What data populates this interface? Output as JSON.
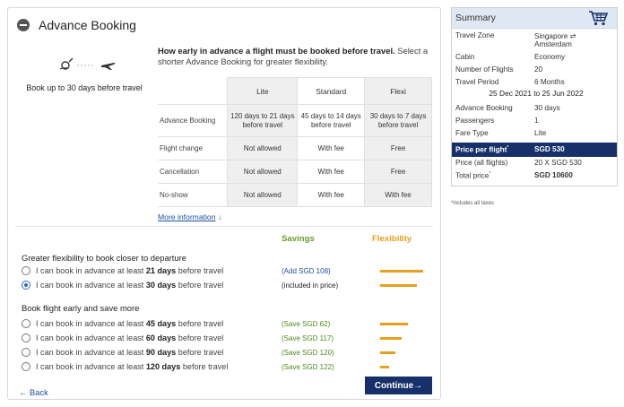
{
  "header": {
    "title": "Advance Booking"
  },
  "limit_text": "Book up to 30 days before travel",
  "description": {
    "bold": "How early in advance a flight must be booked before travel.",
    "rest": " Select a shorter Advance Booking for greater flexibility."
  },
  "fare_table": {
    "columns": [
      "Lite",
      "Standard",
      "Flexi"
    ],
    "rows": [
      {
        "label": "Advance Booking",
        "values": [
          "120 days to 21 days before travel",
          "45 days to 14 days before travel",
          "30 days to 7 days before travel"
        ]
      },
      {
        "label": "Flight change",
        "values": [
          "Not allowed",
          "With fee",
          "Free"
        ]
      },
      {
        "label": "Cancellation",
        "values": [
          "Not allowed",
          "With fee",
          "Free"
        ]
      },
      {
        "label": "No-show",
        "values": [
          "Not allowed",
          "With fee",
          "With fee"
        ]
      }
    ]
  },
  "more_info": {
    "label": "More information",
    "arrow": "↓"
  },
  "columns_head": {
    "savings": "Savings",
    "flexibility": "Flexibility"
  },
  "groups": [
    {
      "title": "Greater flexibility to book closer to departure",
      "options": [
        {
          "prefix": "I can book in advance at least",
          "days": "21 days",
          "suffix": "before travel",
          "price": "(Add SGD 108)",
          "price_color": "#1f4fa3",
          "selected": false,
          "flexibility": 1.0
        },
        {
          "prefix": "I can book in advance at least",
          "days": "30 days",
          "suffix": "before travel",
          "price": "(included in price)",
          "price_color": "#222222",
          "selected": true,
          "flexibility": 0.85
        }
      ]
    },
    {
      "title": "Book flight early and save more",
      "options": [
        {
          "prefix": "I can book in advance at least",
          "days": "45 days",
          "suffix": "before travel",
          "price": "(Save SGD 62)",
          "price_color": "#4e8a1e",
          "selected": false,
          "flexibility": 0.65
        },
        {
          "prefix": "I can book in advance at least",
          "days": "60 days",
          "suffix": "before travel",
          "price": "(Save SGD 117)",
          "price_color": "#4e8a1e",
          "selected": false,
          "flexibility": 0.5
        },
        {
          "prefix": "I can book in advance at least",
          "days": "90 days",
          "suffix": "before travel",
          "price": "(Save SGD 120)",
          "price_color": "#4e8a1e",
          "selected": false,
          "flexibility": 0.35
        },
        {
          "prefix": "I can book in advance at least",
          "days": "120 days",
          "suffix": "before travel",
          "price": "(Save SGD 122)",
          "price_color": "#4e8a1e",
          "selected": false,
          "flexibility": 0.2
        }
      ]
    }
  ],
  "nav": {
    "back": "← Back",
    "continue": "Continue→"
  },
  "summary": {
    "title": "Summary",
    "travel_zone": {
      "label": "Travel Zone",
      "line1": "Singapore ⇌",
      "line2": "Amsterdam"
    },
    "cabin": {
      "label": "Cabin",
      "value": "Economy"
    },
    "flights": {
      "label": "Number of Flights",
      "value": "20"
    },
    "period": {
      "label": "Travel Period",
      "value": "6 Months",
      "range": "25 Dec 2021 to 25 Jun 2022"
    },
    "advance": {
      "label": "Advance Booking",
      "value": "30 days"
    },
    "passengers": {
      "label": "Passengers",
      "value": "1"
    },
    "fare_type": {
      "label": "Fare Type",
      "value": "Lite"
    },
    "price_per_flight": {
      "label": "Price per flight",
      "mark": "*",
      "value": "SGD 530"
    },
    "price_all": {
      "label": "Price (all flights)",
      "value": "20 X SGD 530"
    },
    "total": {
      "label": "Total price",
      "mark": "*",
      "value": "SGD  10600"
    },
    "taxes_note": "*includes all taxes"
  },
  "colors": {
    "navy": "#17306a",
    "link": "#1f4fa3",
    "savings": "#6a9b2e",
    "flexibility": "#e8a020"
  }
}
